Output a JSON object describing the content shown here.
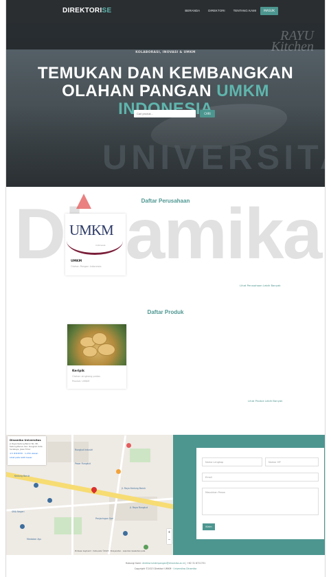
{
  "nav": {
    "brand_main": "DIREKTORI",
    "brand_accent": "SE",
    "links": [
      "BERANDA",
      "DIREKTORI",
      "TENTANG KAMI"
    ],
    "login_label": "MASUK"
  },
  "hero": {
    "tagline": "KOLABORASI, INOVASI & UMKM",
    "headline_line1": "TEMUKAN DAN KEMBANGKAN",
    "headline_line2_a": "OLAHAN PANGAN",
    "headline_line2_b": "UMKM",
    "headline_line3": "INDONESIA",
    "search_placeholder": "Cari produk...",
    "search_button": "CARI",
    "sign_text_1": "RAYU",
    "sign_text_2": "Kitchen"
  },
  "watermark": {
    "word1": "UNIVERSITAS",
    "word2": "Dinamika"
  },
  "companies": {
    "title": "Daftar Perusahaan",
    "items": [
      {
        "logo_text": "UMKM",
        "logo_sub": "indonesia",
        "name": "UMKM",
        "subtitle": "Olahan Pangan Indonesia"
      }
    ],
    "see_all": "Lihat Perusahaan Lebih Banyak"
  },
  "products": {
    "title": "Daftar Produk",
    "items": [
      {
        "name": "Keripik",
        "line1": "Olahan singkong pedas",
        "line2": "Produk: UMKM"
      }
    ],
    "see_all": "Lihat Produk Lebih Banyak"
  },
  "map": {
    "info_title": "Dinamika Universitas",
    "info_address": "Jl. Raya Kedung Baruk No. 98, Kedung Baruk, Kec. Rungkut, Kota Surabaya, Jawa Timur",
    "info_rating": "4.5 ★★★★★ · 1.234 ulasan",
    "info_link": "Lihat peta lebih besar",
    "labels": [
      "Rungkut Industri",
      "Kedung Baruk",
      "Jl. Raya Kedung Baruk",
      "Pasar Rungkut",
      "SMA Negeri",
      "Penjaringan Sari",
      "Jl. Raya Rungkut",
      "Medokan Ayu"
    ],
    "zoom_in": "+",
    "zoom_out": "−",
    "credit": "Pintasan keyboard · Data peta ©2023 · Persyaratan · Laporkan kesalahan peta"
  },
  "contact_form": {
    "name_placeholder": "Nama Lengkap",
    "phone_placeholder": "Nomor HP",
    "email_placeholder": "Email",
    "message_placeholder": "Masukkan Pesan",
    "send_label": "Kirim"
  },
  "footer": {
    "line1_prefix": "Hubungi Kami: ",
    "line1_link": "direktoriumkmpangan@dinamika.ac.id",
    "line1_suffix": " | +62 31 8721731",
    "line2_prefix": "Copyright ©2023 Direktori UMKM · ",
    "line2_link": "Universitas Dinamika"
  },
  "colors": {
    "accent": "#4d9690",
    "nav_bg": "#2a2e31",
    "hero_overlay": "#3a4246",
    "pin": "#d9302f"
  }
}
